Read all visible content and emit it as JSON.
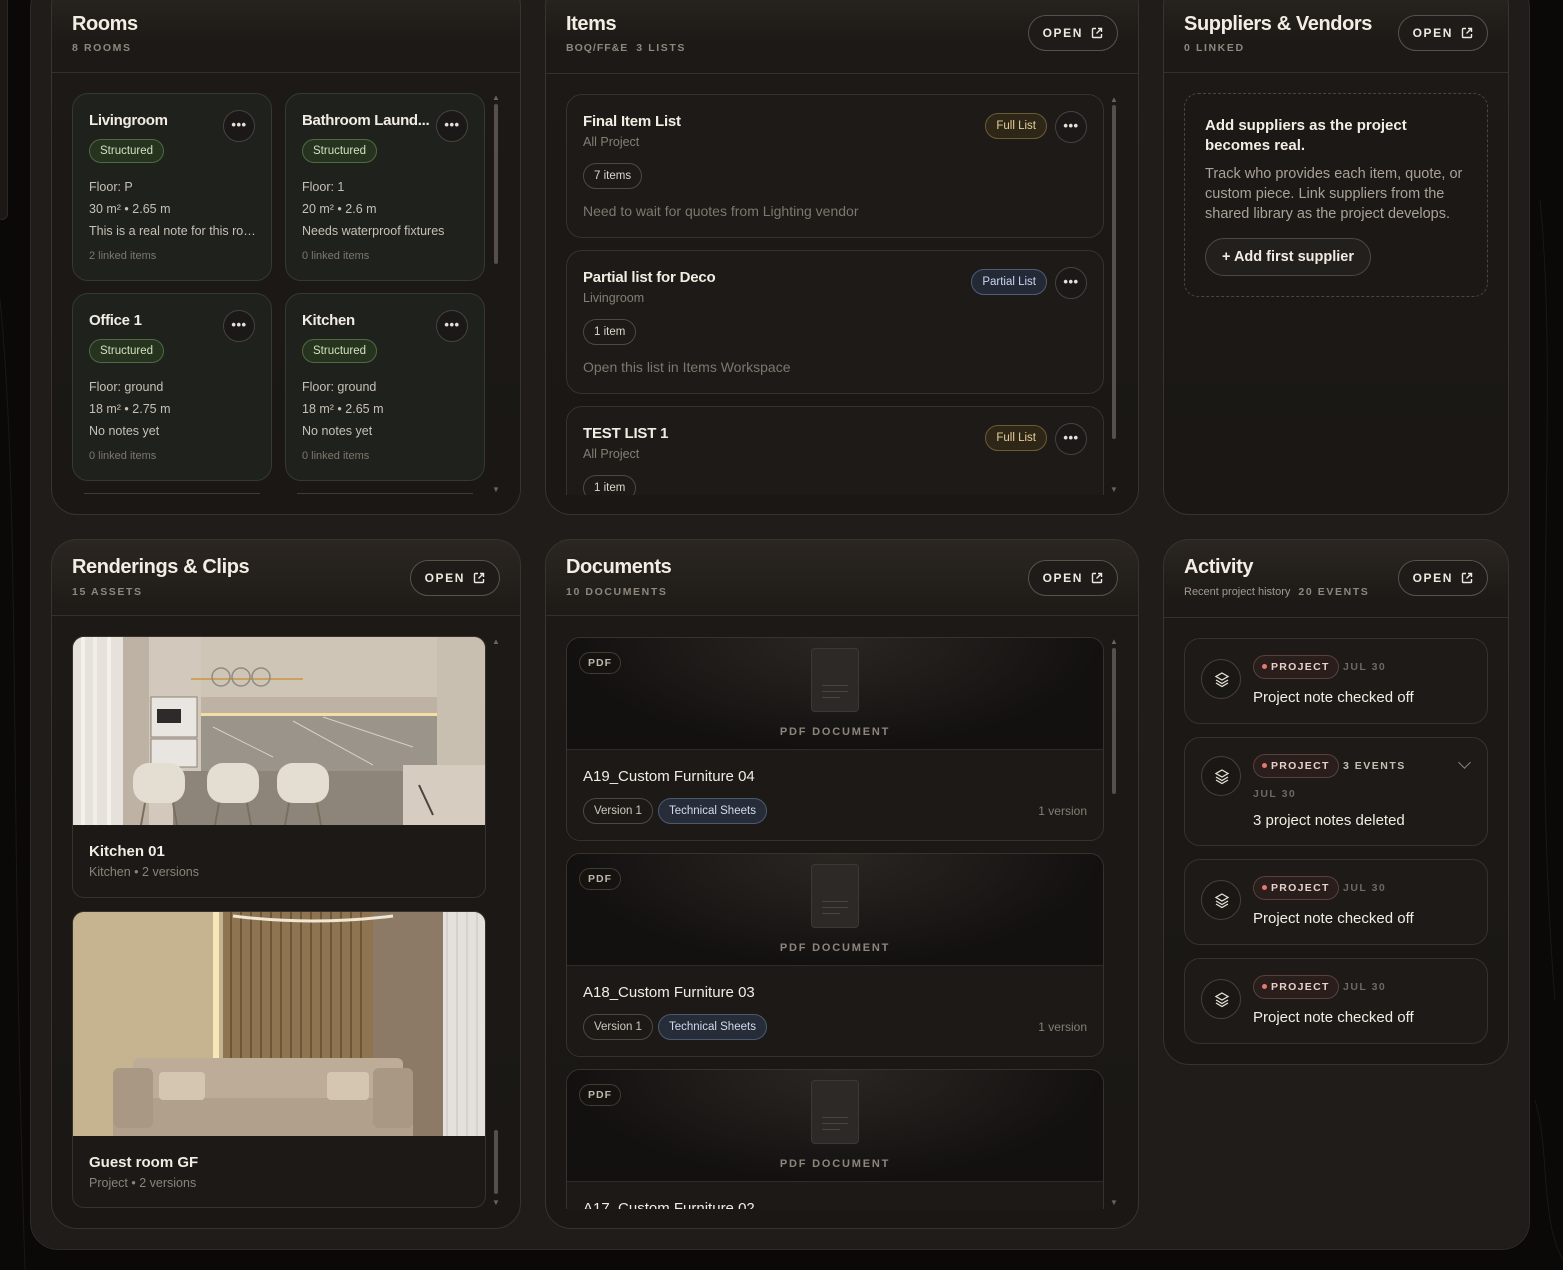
{
  "rooms": {
    "title": "Rooms",
    "subtitle": "8 ROOMS",
    "items": [
      {
        "name": "Livingroom",
        "badge": "Structured",
        "floor": "Floor: P",
        "dims": "30 m² • 2.65 m",
        "note": "This is a real note for this roo...",
        "linked": "2 linked items"
      },
      {
        "name": "Bathroom Laund...",
        "badge": "Structured",
        "floor": "Floor: 1",
        "dims": "20 m² • 2.6 m",
        "note": "Needs waterproof fixtures",
        "linked": "0 linked items"
      },
      {
        "name": "Office 1",
        "badge": "Structured",
        "floor": "Floor: ground",
        "dims": "18 m² • 2.75 m",
        "note": "No notes yet",
        "linked": "0 linked items"
      },
      {
        "name": "Kitchen",
        "badge": "Structured",
        "floor": "Floor: ground",
        "dims": "18 m² • 2.65 m",
        "note": "No notes yet",
        "linked": "0 linked items"
      }
    ],
    "more_label": "..."
  },
  "items_panel": {
    "title": "Items",
    "subtitle": "BOQ/FF&E",
    "subtitle2": "3 LISTS",
    "open_label": "OPEN",
    "lists": [
      {
        "name": "Final Item List",
        "scope": "All Project",
        "tag": "Full List",
        "count": "7 items",
        "note": "Need to wait for quotes from Lighting vendor",
        "more": "..."
      },
      {
        "name": "Partial list for Deco",
        "scope": "Livingroom",
        "tag": "Partial List",
        "count": "1 item",
        "note": "Open this list in Items Workspace",
        "more": "..."
      },
      {
        "name": "TEST LIST 1",
        "scope": "All Project",
        "tag": "Full List",
        "count": "1 item",
        "note": "",
        "more": "..."
      }
    ]
  },
  "suppliers": {
    "title": "Suppliers & Vendors",
    "subtitle": "0 LINKED",
    "open_label": "OPEN",
    "empty_title": "Add suppliers as the project becomes real.",
    "empty_desc": "Track who provides each item, quote, or custom piece. Link suppliers from the shared library as the project develops.",
    "add_button": "+ Add first supplier"
  },
  "renderings": {
    "title": "Renderings & Clips",
    "subtitle": "15 ASSETS",
    "open_label": "OPEN",
    "assets": [
      {
        "name": "Kitchen 01",
        "meta": "Kitchen • 2 versions"
      },
      {
        "name": "Guest room GF",
        "meta": "Project • 2 versions"
      }
    ]
  },
  "documents": {
    "title": "Documents",
    "subtitle": "10 DOCUMENTS",
    "open_label": "OPEN",
    "docs": [
      {
        "type": "PDF",
        "preview_label": "PDF DOCUMENT",
        "name": "A19_Custom Furniture 04",
        "version": "Version 1",
        "category": "Technical Sheets",
        "versions": "1 version"
      },
      {
        "type": "PDF",
        "preview_label": "PDF DOCUMENT",
        "name": "A18_Custom Furniture 03",
        "version": "Version 1",
        "category": "Technical Sheets",
        "versions": "1 version"
      },
      {
        "type": "PDF",
        "preview_label": "PDF DOCUMENT",
        "name": "A17_Custom Furniture 02",
        "version": "",
        "category": "",
        "versions": ""
      }
    ]
  },
  "activity": {
    "title": "Activity",
    "subtitle_text": "Recent project history",
    "subtitle": "20 EVENTS",
    "open_label": "OPEN",
    "events": [
      {
        "tag": "PROJECT",
        "date": "JUL 30",
        "events": "",
        "text": "Project note checked off"
      },
      {
        "tag": "PROJECT",
        "date": "JUL 30",
        "events": "3 EVENTS",
        "text": "3 project notes deleted"
      },
      {
        "tag": "PROJECT",
        "date": "JUL 30",
        "events": "",
        "text": "Project note checked off"
      },
      {
        "tag": "PROJECT",
        "date": "JUL 30",
        "events": "",
        "text": "Project note checked off"
      }
    ]
  },
  "colors": {
    "background": "#0a0908",
    "panel": "#1a1715",
    "structured_badge": "#26331f",
    "full_list_tag": "#2e2718",
    "partial_list_tag": "#232a36",
    "project_dot": "#e07a6c"
  },
  "icons": [
    "more-dots-icon",
    "external-link-icon",
    "file-icon",
    "layers-icon",
    "chevron-down-icon"
  ]
}
